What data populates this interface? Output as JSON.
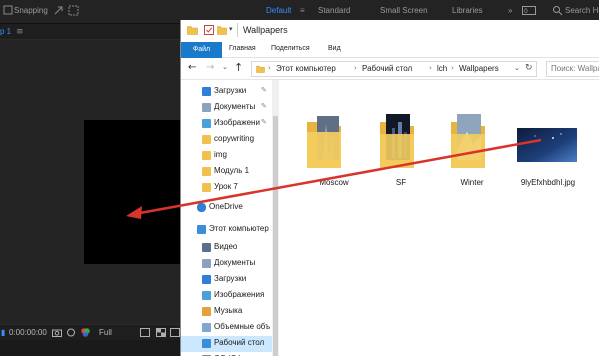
{
  "ae": {
    "snapping_label": "Snapping",
    "workspaces": [
      "Default",
      "Standard",
      "Small Screen",
      "Libraries"
    ],
    "search_label": "Search He",
    "comp_tab": "p 1",
    "menu_glyph": "≡",
    "timecode": "0:00:00:00",
    "quality": "Full",
    "accent_color": "#3b8cff"
  },
  "explorer": {
    "title": "Wallpapers",
    "ribbon_tabs": {
      "file": "Файл",
      "home": "Главная",
      "share": "Поделиться",
      "view": "Вид"
    },
    "breadcrumbs": [
      "Этот компьютер",
      "Рабочий стол",
      "lch",
      "Wallpapers"
    ],
    "search_placeholder": "Поиск: Wallpa",
    "nav_items": [
      {
        "label": "Загрузки",
        "icon": "downloads-icon",
        "pinned": true
      },
      {
        "label": "Документы",
        "icon": "documents-icon",
        "pinned": true
      },
      {
        "label": "Изображени",
        "icon": "pictures-icon",
        "pinned": true
      },
      {
        "label": "copywriting",
        "icon": "folder-icon",
        "pinned": false
      },
      {
        "label": "img",
        "icon": "folder-icon",
        "pinned": false
      },
      {
        "label": "Модуль 1",
        "icon": "folder-icon",
        "pinned": false
      },
      {
        "label": "Урок 7",
        "icon": "folder-icon",
        "pinned": false
      },
      {
        "label": "OneDrive",
        "icon": "onedrive-icon",
        "pinned": false
      },
      {
        "label": "Этот компьютер",
        "icon": "this-pc-icon",
        "pinned": false
      },
      {
        "label": "Видео",
        "icon": "videos-icon",
        "pinned": false
      },
      {
        "label": "Документы",
        "icon": "documents-icon",
        "pinned": false
      },
      {
        "label": "Загрузки",
        "icon": "downloads-icon",
        "pinned": false
      },
      {
        "label": "Изображения",
        "icon": "pictures-icon",
        "pinned": false
      },
      {
        "label": "Музыка",
        "icon": "music-icon",
        "pinned": false
      },
      {
        "label": "Объемные объ",
        "icon": "3d-objects-icon",
        "pinned": false
      },
      {
        "label": "Рабочий стол",
        "icon": "desktop-icon",
        "pinned": false,
        "selected": true
      },
      {
        "label": "OS (C:)",
        "icon": "drive-icon",
        "pinned": false
      }
    ],
    "files": [
      {
        "name": "Moscow",
        "type": "folder"
      },
      {
        "name": "SF",
        "type": "folder"
      },
      {
        "name": "Winter",
        "type": "folder"
      },
      {
        "name": "9lyEfxhbdhl.jpg",
        "type": "image"
      }
    ],
    "accent_color": "#1979ca",
    "selection_color": "#cce8ff"
  },
  "drag_arrow_color": "#d9342b"
}
